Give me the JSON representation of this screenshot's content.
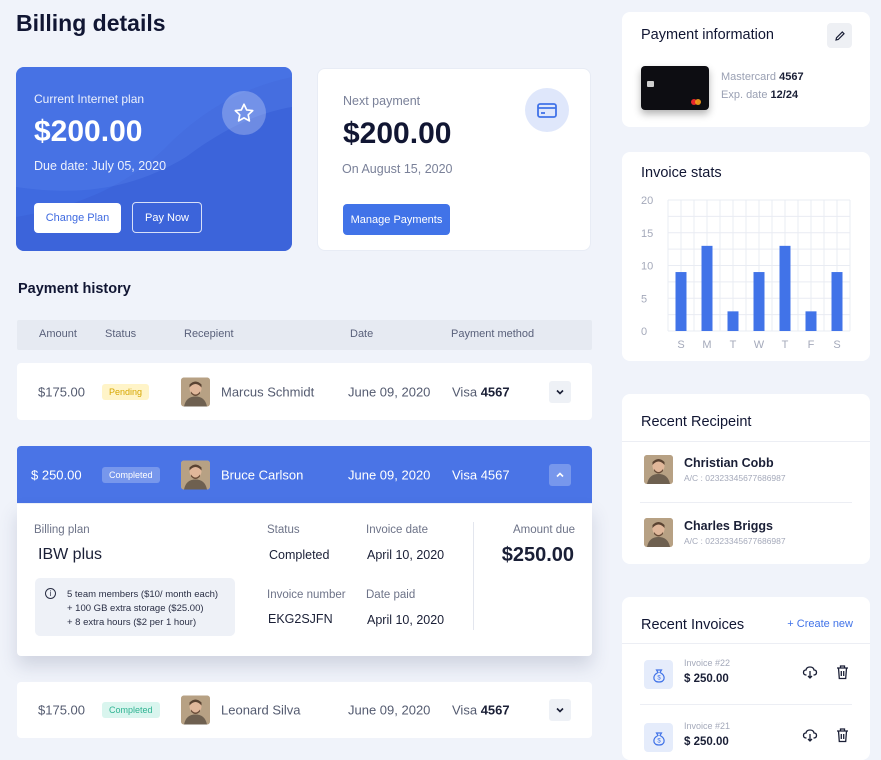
{
  "page": {
    "title": "Billing details"
  },
  "plan": {
    "label": "Current  Internet plan",
    "amount": "$200.00",
    "due": "Due date:  July 05, 2020",
    "change_label": "Change Plan",
    "pay_label": "Pay Now",
    "icon": "star-icon"
  },
  "next_payment": {
    "label": "Next payment",
    "amount": "$200.00",
    "date": "On August 15, 2020",
    "manage_label": "Manage Payments",
    "icon": "credit-card-icon"
  },
  "history": {
    "title": "Payment history",
    "columns": [
      "Amount",
      "Status",
      "Recepient",
      "Date",
      "Payment method"
    ],
    "rows": [
      {
        "amount": "$175.00",
        "status": "Pending",
        "name": "Marcus Schmidt",
        "date": "June 09, 2020",
        "method": "Visa",
        "last4": "4567"
      },
      {
        "amount": "$ 250.00",
        "status": "Completed",
        "name": "Bruce Carlson",
        "date": "June 09, 2020",
        "method": "Visa",
        "last4": "4567"
      },
      {
        "amount": "$175.00",
        "status": "Completed",
        "name": "Leonard Silva",
        "date": "June 09, 2020",
        "method": "Visa",
        "last4": "4567"
      }
    ],
    "detail": {
      "billing_plan_label": "Billing plan",
      "billing_plan": "IBW plus",
      "status_label": "Status",
      "status": "Completed",
      "invoice_date_label": "Invoice date",
      "invoice_date": "April 10, 2020",
      "invoice_number_label": "Invoice number",
      "invoice_number": "EKG2SJFN",
      "date_paid_label": "Date paid",
      "date_paid": "April 10, 2020",
      "amount_due_label": "Amount due",
      "amount_due": "$250.00",
      "notes": [
        "5 team members ($10/ month each)",
        "+ 100 GB  extra storage ($25.00)",
        "+  8 extra hours ($2 per 1 hour)"
      ]
    }
  },
  "payment_info": {
    "title": "Payment information",
    "card_brand": "Mastercard",
    "card_last4": "4567",
    "exp_label": "Exp. date",
    "exp": "12/24"
  },
  "invoice_stats": {
    "title": "Invoice stats"
  },
  "chart_data": {
    "type": "bar",
    "categories": [
      "S",
      "M",
      "T",
      "W",
      "T",
      "F",
      "S"
    ],
    "values": [
      9,
      13,
      3,
      9,
      13,
      3,
      9
    ],
    "yticks": [
      0,
      5,
      10,
      15,
      20
    ],
    "ylim": [
      0,
      20
    ],
    "grid": true,
    "color": "#4173e8"
  },
  "recent_recipient": {
    "title": "Recent Recipeint",
    "items": [
      {
        "name": "Christian Cobb",
        "account": "A/C : 02323345677686987"
      },
      {
        "name": "Charles Briggs",
        "account": "A/C : 02323345677686987"
      }
    ]
  },
  "recent_invoices": {
    "title": "Recent Invoices",
    "create_label": "+ Create new",
    "items": [
      {
        "number": "Invoice #22",
        "amount": "$ 250.00"
      },
      {
        "number": "Invoice #21",
        "amount": "$ 250.00"
      }
    ]
  },
  "colors": {
    "accent": "#4173e8",
    "pending": "#fff4c8",
    "completed": "#d9f5ee"
  }
}
